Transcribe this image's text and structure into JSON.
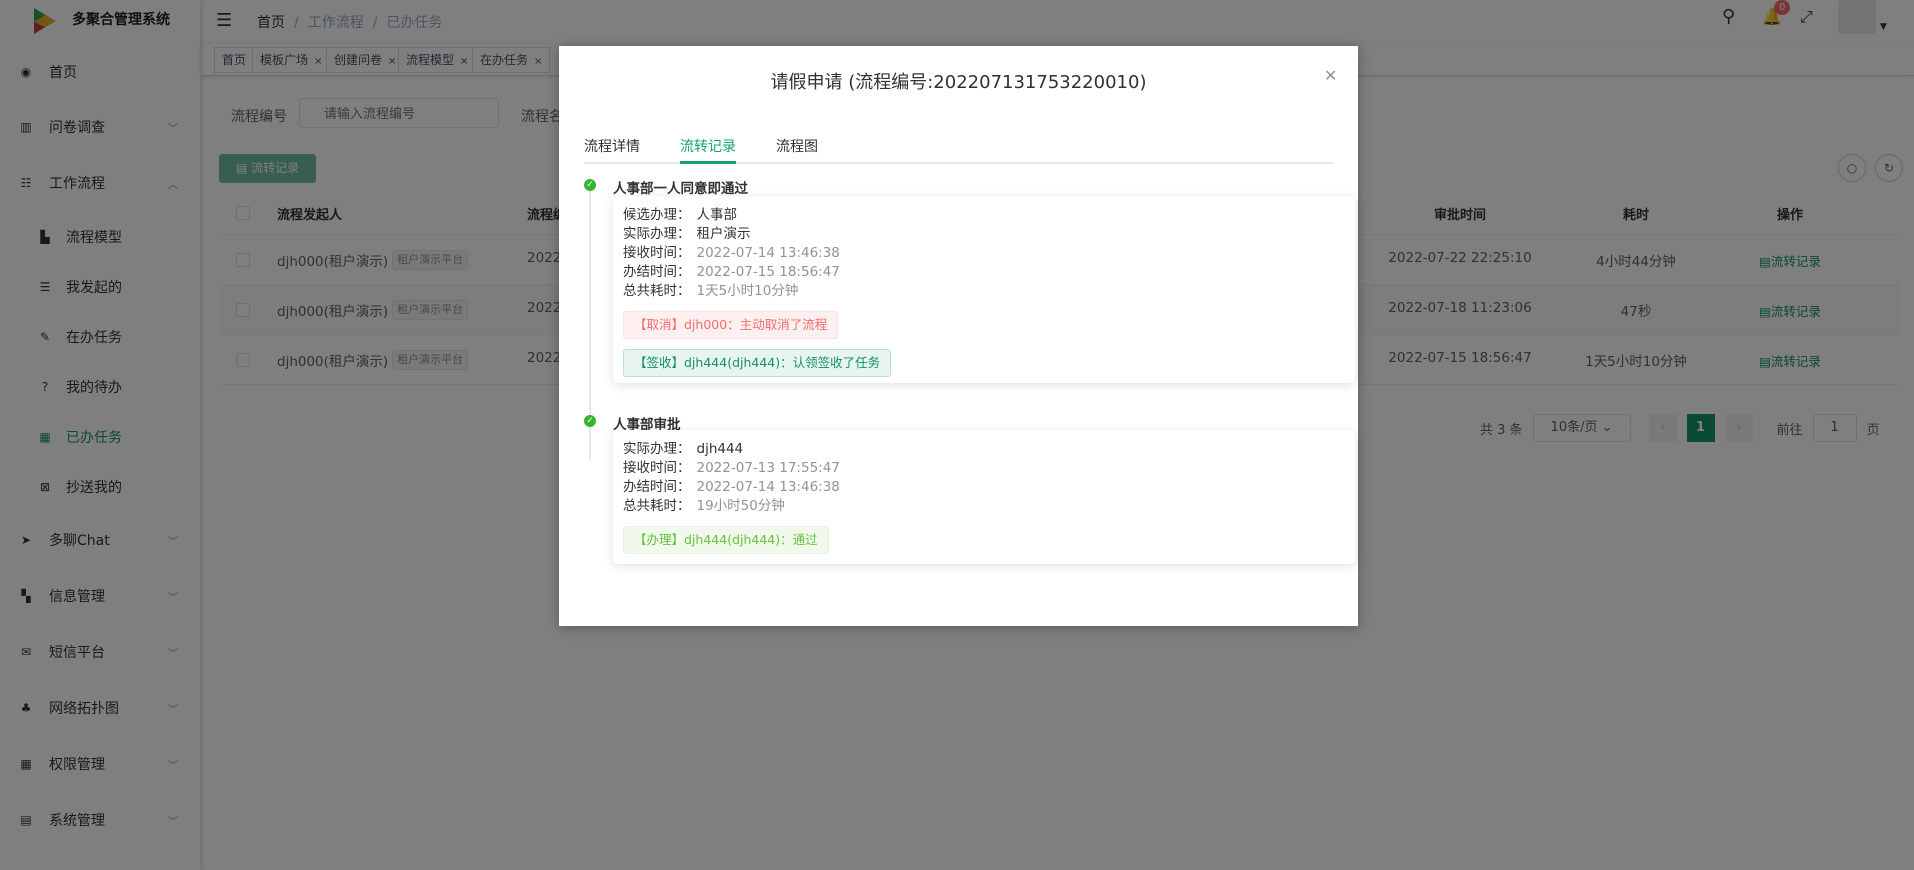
{
  "app": {
    "title": "多聚合管理系统"
  },
  "sidebar": {
    "items": [
      {
        "label": "首页",
        "icon": "dashboard-icon"
      },
      {
        "label": "问卷调查",
        "icon": "excel-icon"
      },
      {
        "label": "工作流程",
        "icon": "workflow-icon"
      },
      {
        "label": "流程模型",
        "icon": "file-edit-icon"
      },
      {
        "label": "我发起的",
        "icon": "sliders-icon"
      },
      {
        "label": "在办任务",
        "icon": "edit-icon"
      },
      {
        "label": "我的待办",
        "icon": "question-icon"
      },
      {
        "label": "已办任务",
        "icon": "done-list-icon"
      },
      {
        "label": "抄送我的",
        "icon": "cc-icon"
      },
      {
        "label": "多聊Chat",
        "icon": "paper-plane-icon"
      },
      {
        "label": "信息管理",
        "icon": "copy-icon"
      },
      {
        "label": "短信平台",
        "icon": "envelope-icon"
      },
      {
        "label": "网络拓扑图",
        "icon": "sitemap-icon"
      },
      {
        "label": "权限管理",
        "icon": "table-icon"
      },
      {
        "label": "系统管理",
        "icon": "file-icon"
      }
    ]
  },
  "header": {
    "breadcrumb": [
      "首页",
      "工作流程",
      "已办任务"
    ],
    "notification_count": "0"
  },
  "tags": [
    {
      "label": "首页"
    },
    {
      "label": "模板广场"
    },
    {
      "label": "创建问卷"
    },
    {
      "label": "流程模型"
    },
    {
      "label": "在办任务"
    }
  ],
  "filters": {
    "process_no_label": "流程编号",
    "process_no_placeholder": "请输入流程编号",
    "process_name_label": "流程名"
  },
  "toolbar": {
    "record_button": "流转记录"
  },
  "table": {
    "columns": [
      "流程发起人",
      "流程编号",
      "审批时间",
      "耗时",
      "操作"
    ],
    "rows": [
      {
        "initiator": "djh000(租户演示)",
        "tenant": "租户演示平台",
        "number": "2022",
        "approve_time": "2022-07-22 22:25:10",
        "duration": "4小时44分钟",
        "action": "流转记录"
      },
      {
        "initiator": "djh000(租户演示)",
        "tenant": "租户演示平台",
        "number": "2022",
        "approve_time": "2022-07-18 11:23:06",
        "duration": "47秒",
        "action": "流转记录"
      },
      {
        "initiator": "djh000(租户演示)",
        "tenant": "租户演示平台",
        "number": "2022",
        "approve_time": "2022-07-15 18:56:47",
        "duration": "1天5小时10分钟",
        "action": "流转记录"
      }
    ]
  },
  "pagination": {
    "total": "共 3 条",
    "page_size": "10条/页",
    "current": "1",
    "goto_label": "前往",
    "goto_value": "1",
    "page_suffix": "页"
  },
  "modal": {
    "title": "请假申请 (流程编号:202207131753220010)",
    "tabs": [
      {
        "label": "流程详情"
      },
      {
        "label": "流转记录",
        "active": true
      },
      {
        "label": "流程图"
      }
    ],
    "timeline": [
      {
        "title": "人事部一人同意即通过",
        "fields": [
          {
            "k": "候选办理：",
            "v": "人事部"
          },
          {
            "k": "实际办理：",
            "v": "租户演示"
          },
          {
            "k": "接收时间：",
            "v": "2022-07-14 13:46:38"
          },
          {
            "k": "办结时间：",
            "v": "2022-07-15 18:56:47"
          },
          {
            "k": "总共耗时：",
            "v": "1天5小时10分钟"
          }
        ],
        "messages": [
          {
            "text": "【取消】djh000：主动取消了流程",
            "type": "danger"
          },
          {
            "text": "【签收】djh444(djh444)：认领签收了任务",
            "type": "primary"
          }
        ]
      },
      {
        "title": "人事部审批",
        "fields": [
          {
            "k": "实际办理：",
            "v": "djh444"
          },
          {
            "k": "接收时间：",
            "v": "2022-07-13 17:55:47"
          },
          {
            "k": "办结时间：",
            "v": "2022-07-14 13:46:38"
          },
          {
            "k": "总共耗时：",
            "v": "19小时50分钟"
          }
        ],
        "messages": [
          {
            "text": "【办理】djh444(djh444)：通过",
            "type": "success"
          }
        ]
      }
    ]
  },
  "colors": {
    "primary": "#13926a",
    "danger": "#f56c6c",
    "success": "#67c23a",
    "badge": "#f56c6c"
  }
}
